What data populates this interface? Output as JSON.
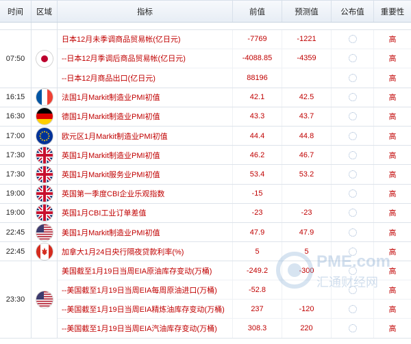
{
  "header": {
    "time": "时间",
    "region": "区域",
    "indicator": "指标",
    "previous": "前值",
    "forecast": "预测值",
    "published": "公布值",
    "importance": "重要性"
  },
  "groups": [
    {
      "time": "",
      "flag": "none",
      "rows": []
    },
    {
      "time": "07:50",
      "flag": "japan-flag-icon",
      "rows": [
        {
          "indicator": "日本12月未季调商品贸易帐(亿日元)",
          "previous": "-7769",
          "forecast": "-1221",
          "importance": "高"
        },
        {
          "indicator": "--日本12月季调后商品贸易帐(亿日元)",
          "previous": "-4088.85",
          "forecast": "-4359",
          "importance": "高"
        },
        {
          "indicator": "--日本12月商品出口(亿日元)",
          "previous": "88196",
          "forecast": "",
          "importance": "高"
        }
      ]
    },
    {
      "time": "16:15",
      "flag": "france-flag-icon",
      "rows": [
        {
          "indicator": "法国1月Markit制造业PMI初值",
          "previous": "42.1",
          "forecast": "42.5",
          "importance": "高"
        }
      ]
    },
    {
      "time": "16:30",
      "flag": "germany-flag-icon",
      "rows": [
        {
          "indicator": "德国1月Markit制造业PMI初值",
          "previous": "43.3",
          "forecast": "43.7",
          "importance": "高"
        }
      ]
    },
    {
      "time": "17:00",
      "flag": "eu-flag-icon",
      "rows": [
        {
          "indicator": "欧元区1月Markit制造业PMI初值",
          "previous": "44.4",
          "forecast": "44.8",
          "importance": "高"
        }
      ]
    },
    {
      "time": "17:30",
      "flag": "uk-flag-icon",
      "rows": [
        {
          "indicator": "英国1月Markit制造业PMI初值",
          "previous": "46.2",
          "forecast": "46.7",
          "importance": "高"
        }
      ]
    },
    {
      "time": "17:30",
      "flag": "uk-flag-icon",
      "rows": [
        {
          "indicator": "英国1月Markit服务业PMI初值",
          "previous": "53.4",
          "forecast": "53.2",
          "importance": "高"
        }
      ]
    },
    {
      "time": "19:00",
      "flag": "uk-flag-icon",
      "rows": [
        {
          "indicator": "英国第一季度CBI企业乐观指数",
          "previous": "-15",
          "forecast": "",
          "importance": "高"
        }
      ]
    },
    {
      "time": "19:00",
      "flag": "uk-flag-icon",
      "rows": [
        {
          "indicator": "英国1月CBI工业订单差值",
          "previous": "-23",
          "forecast": "-23",
          "importance": "高"
        }
      ]
    },
    {
      "time": "22:45",
      "flag": "usa-flag-icon",
      "rows": [
        {
          "indicator": "美国1月Markit制造业PMI初值",
          "previous": "47.9",
          "forecast": "47.9",
          "importance": "高"
        }
      ]
    },
    {
      "time": "22:45",
      "flag": "canada-flag-icon",
      "rows": [
        {
          "indicator": "加拿大1月24日央行隔夜贷款利率(%)",
          "previous": "5",
          "forecast": "5",
          "importance": "高"
        }
      ]
    },
    {
      "time": "23:30",
      "flag": "usa-flag-icon",
      "rows": [
        {
          "indicator": "美国截至1月19日当周EIA原油库存变动(万桶)",
          "previous": "-249.2",
          "forecast": "-300",
          "importance": "高"
        },
        {
          "indicator": "--美国截至1月19日当周EIA每周原油进口(万桶)",
          "previous": "-52.8",
          "forecast": "",
          "importance": "高"
        },
        {
          "indicator": "--美国截至1月19日当周EIA精炼油库存变动(万桶)",
          "previous": "237",
          "forecast": "-120",
          "importance": "高"
        },
        {
          "indicator": "--美国截至1月19日当周EIA汽油库存变动(万桶)",
          "previous": "308.3",
          "forecast": "220",
          "importance": "高"
        }
      ]
    }
  ],
  "watermark": {
    "line1": "PME.com",
    "line2": "汇通财经网"
  }
}
